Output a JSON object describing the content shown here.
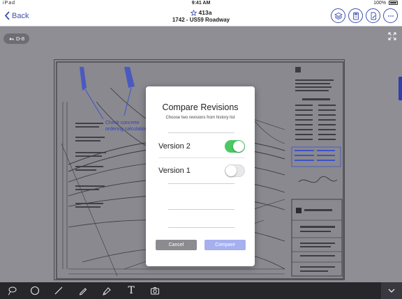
{
  "status_bar": {
    "left": "iPad",
    "time": "9:41 AM",
    "battery": "100%"
  },
  "nav": {
    "back_label": "Back",
    "sheet_number": "413a",
    "sheet_title": "1742 - US59 Roadway",
    "accent": "#3c4fb0",
    "buttons": [
      "layers-icon",
      "calculator-icon",
      "document-edit-icon",
      "more-icon"
    ]
  },
  "viewer": {
    "badge_label": "D-8",
    "annotation_text": [
      "Check concrete",
      "ordering calculation"
    ]
  },
  "modal": {
    "title": "Compare Revisions",
    "subtitle": "Choose two revisions from history list",
    "revisions": [
      {
        "label": "Version 2",
        "selected": true
      },
      {
        "label": "Version 1",
        "selected": false
      }
    ],
    "cancel_label": "Cancel",
    "compare_label": "Compare",
    "toggle_on_color": "#4bc764",
    "compare_color": "#a6b0ee"
  },
  "toolbar": {
    "tools": [
      "lasso-icon",
      "circle-icon",
      "line-icon",
      "pen-icon",
      "highlighter-icon",
      "text-icon",
      "camera-icon"
    ],
    "text_tool_glyph": "T"
  }
}
